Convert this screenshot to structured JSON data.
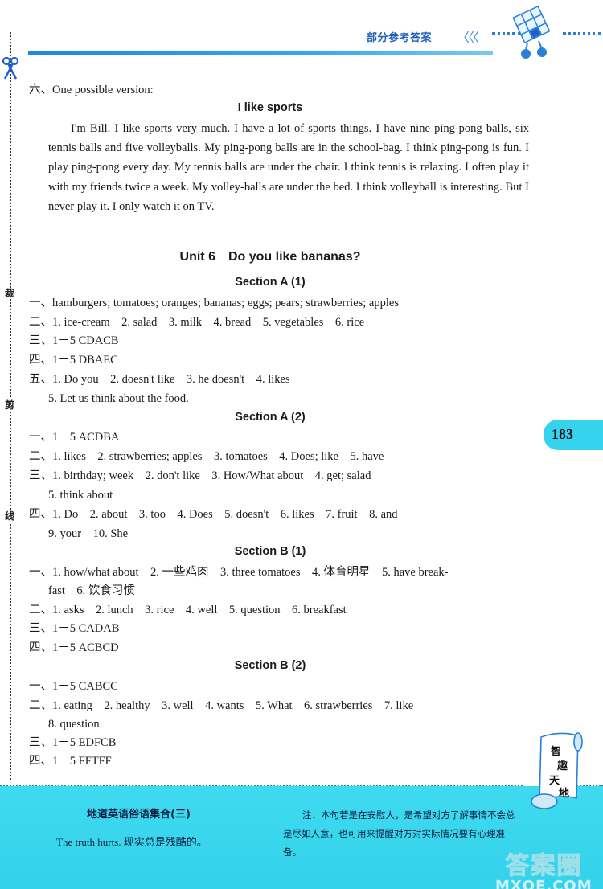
{
  "header": {
    "label": "部分参考答案",
    "chevrons": "《《《",
    "mascot": "rubiks-cube-mascot"
  },
  "cut_line": {
    "chars": [
      "裁",
      "剪",
      "线"
    ]
  },
  "essay": {
    "intro": "六、One possible version:",
    "title": "I like sports",
    "body": "I'm Bill. I like sports very much. I have a lot of sports things. I have nine ping-pong balls, six tennis balls and five volleyballs. My ping-pong balls are in the school-bag. I think ping-pong is fun. I play ping-pong every day. My tennis balls are under the chair. I think tennis is relaxing. I often play it with my friends twice a week. My volley-balls are under the bed. I think volleyball is interesting. But I never play it. I only watch it on TV."
  },
  "unit": {
    "title": "Unit 6　Do you like bananas?",
    "sections": [
      {
        "title": "Section A (1)",
        "lines": [
          "一、hamburgers; tomatoes; oranges; bananas; eggs; pears; strawberries; apples",
          "二、1. ice-cream　2. salad　3. milk　4. bread　5. vegetables　6. rice",
          "三、1－5 CDACB",
          "四、1－5 DBAEC",
          "五、1. Do you　2. doesn't like　3. he doesn't　4. likes",
          "5. Let us think about the food."
        ]
      },
      {
        "title": "Section A (2)",
        "lines": [
          "一、1－5 ACDBA",
          "二、1. likes　2. strawberries; apples　3. tomatoes　4. Does; like　5. have",
          "三、1. birthday; week　2. don't like　3. How/What about　4. get; salad",
          "5. think about",
          "四、1. Do　2. about　3. too　4. Does　5. doesn't　6. likes　7. fruit　8. and",
          "9. your　10. She"
        ]
      },
      {
        "title": "Section B (1)",
        "lines": [
          "一、1. how/what about　2. 一些鸡肉　3. three tomatoes　4. 体育明星　5. have break-",
          "fast　6. 饮食习惯",
          "二、1. asks　2. lunch　3. rice　4. well　5. question　6. breakfast",
          "三、1－5 CADAB",
          "四、1－5 ACBCD"
        ]
      },
      {
        "title": "Section B (2)",
        "lines": [
          "一、1－5 CABCC",
          "二、1. eating　2. healthy　3. well　4. wants　5. What　6. strawberries　7. like",
          "8. question",
          "三、1－5 EDFCB",
          "四、1－5 FFTFF"
        ]
      }
    ]
  },
  "page_number": "183",
  "footer": {
    "title": "地道英语俗语集合(三)",
    "proverb": "The truth hurts. 现实总是残酷的。",
    "note": "注：本句若是在安慰人，是希望对方了解事情不会总是尽如人意，也可用来提醒对方对实际情况要有心理准备。",
    "scroll_text": [
      "智",
      "趣",
      "天",
      "地"
    ],
    "watermark_line1": "答案圈",
    "watermark_line2": "MXQE.COM"
  },
  "colors": {
    "accent_blue": "#1f5fb8",
    "footer_cyan": "#3fdaf0"
  }
}
